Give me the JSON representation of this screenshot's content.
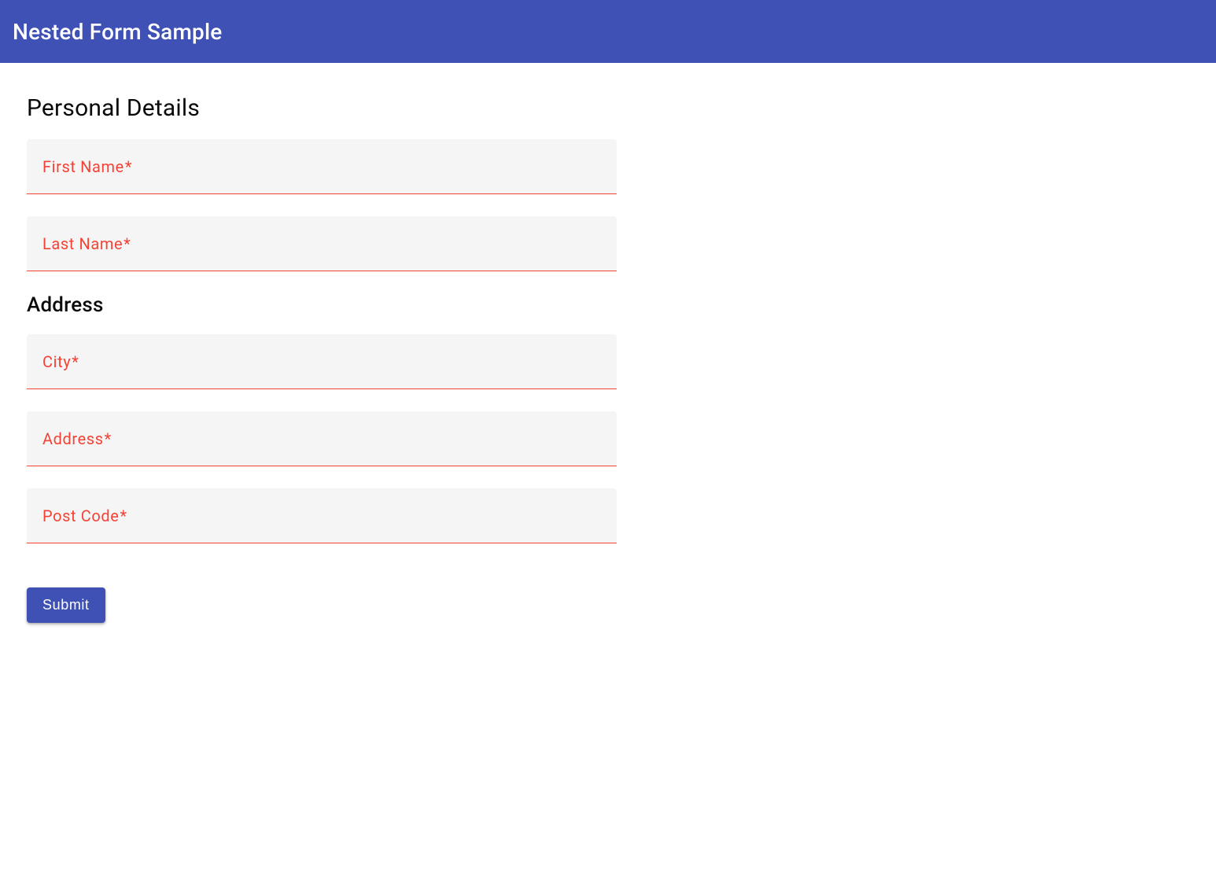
{
  "header": {
    "title": "Nested Form Sample"
  },
  "sections": {
    "personal": {
      "heading": "Personal Details",
      "fields": {
        "first_name": {
          "label": "First Name",
          "required": "*",
          "value": ""
        },
        "last_name": {
          "label": "Last Name",
          "required": "*",
          "value": ""
        }
      }
    },
    "address": {
      "heading": "Address",
      "fields": {
        "city": {
          "label": "City",
          "required": "*",
          "value": ""
        },
        "address": {
          "label": "Address",
          "required": "*",
          "value": ""
        },
        "post_code": {
          "label": "Post Code",
          "required": "*",
          "value": ""
        }
      }
    }
  },
  "actions": {
    "submit_label": "Submit"
  },
  "colors": {
    "primary": "#3f51b5",
    "error": "#f44336",
    "field_bg": "#f5f5f5"
  }
}
